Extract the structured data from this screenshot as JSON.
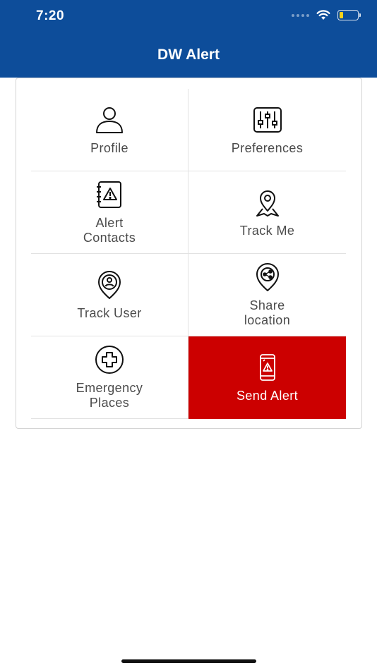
{
  "status_bar": {
    "time": "7:20",
    "battery_color": "#f7d21b"
  },
  "header": {
    "title": "DW Alert",
    "background": "#0d4d9a"
  },
  "menu": {
    "items": [
      {
        "label": "Profile",
        "icon": "person-icon"
      },
      {
        "label": "Preferences",
        "icon": "sliders-icon"
      },
      {
        "label": "Alert\nContacts",
        "icon": "contact-book-warning-icon"
      },
      {
        "label": "Track Me",
        "icon": "map-pin-icon"
      },
      {
        "label": "Track User",
        "icon": "user-location-pin-icon"
      },
      {
        "label": "Share\nlocation",
        "icon": "share-location-pin-icon"
      },
      {
        "label": "Emergency\nPlaces",
        "icon": "medical-cross-icon"
      },
      {
        "label": "Send Alert",
        "icon": "phone-warning-icon"
      }
    ],
    "alert_color": "#cc0000"
  }
}
